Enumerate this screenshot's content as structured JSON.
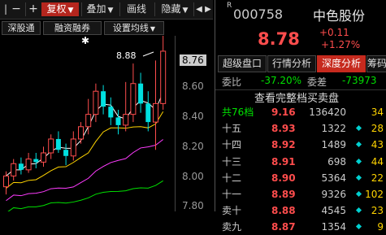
{
  "toolbar": {
    "prev": "|",
    "minus": "−",
    "plus": "+",
    "fuquan": "复权",
    "diejia": "叠加",
    "huaxian": "画线",
    "yincang": "隐藏",
    "arrow_left": "◀",
    "arrow_right": "▶"
  },
  "subbar": {
    "shengutong": "深股通",
    "rongzi": "融资融券",
    "shezhi": "设置均线"
  },
  "chart": {
    "high_marker": "8.88",
    "axis_labels": [
      "8.76",
      "8.60",
      "8.40",
      "8.20",
      "8.00",
      "7.80"
    ]
  },
  "chart_data": {
    "type": "candlestick",
    "ohlc": [
      [
        7.88,
        7.95,
        7.83,
        7.98
      ],
      [
        7.95,
        8.03,
        7.92,
        8.06
      ],
      [
        8.03,
        7.99,
        7.96,
        8.07
      ],
      [
        7.99,
        8.06,
        7.97,
        8.1
      ],
      [
        8.06,
        8.04,
        8.0,
        8.1
      ],
      [
        8.04,
        8.1,
        8.01,
        8.14
      ],
      [
        8.1,
        8.19,
        8.06,
        8.22
      ],
      [
        8.19,
        8.12,
        8.1,
        8.24
      ],
      [
        8.12,
        8.08,
        8.02,
        8.16
      ],
      [
        8.08,
        8.19,
        8.05,
        8.24
      ],
      [
        8.19,
        8.27,
        8.16,
        8.3
      ],
      [
        8.27,
        8.35,
        8.22,
        8.45
      ],
      [
        8.35,
        8.5,
        8.3,
        8.55
      ],
      [
        8.5,
        8.4,
        8.35,
        8.54
      ],
      [
        8.4,
        8.33,
        8.28,
        8.46
      ],
      [
        8.33,
        8.28,
        8.22,
        8.38
      ],
      [
        8.28,
        8.35,
        8.24,
        8.56
      ],
      [
        8.35,
        8.55,
        8.3,
        8.68
      ],
      [
        8.55,
        8.42,
        8.36,
        8.62
      ],
      [
        8.42,
        8.3,
        8.24,
        8.5
      ],
      [
        8.3,
        8.42,
        8.12,
        8.7
      ],
      [
        8.42,
        8.76,
        8.38,
        8.88
      ]
    ],
    "ylim": [
      7.72,
      8.86
    ],
    "ma_colors": [
      "#ffffff",
      "#ffd400",
      "#ff3cff",
      "#00e000"
    ]
  },
  "quote": {
    "code_prefix": "R",
    "code": "000758",
    "name": "中色股份",
    "price": "8.78",
    "change": "+0.11",
    "change_pct": "+1.27%"
  },
  "tabs": [
    "超级盘口",
    "行情分析",
    "深度分析",
    "筹码"
  ],
  "stats": {
    "weibi_label": "委比",
    "weibi_value": "-37.20%",
    "weicha_label": "委差",
    "weicha_value": "-73973"
  },
  "order_book": {
    "title": "查看完整档买卖盘",
    "rows": [
      {
        "label": "共76档",
        "price": "9.16",
        "vol": "136420",
        "count": "34",
        "dot": false
      },
      {
        "label": "十五",
        "price": "8.93",
        "vol": "1322",
        "count": "28",
        "dot": true
      },
      {
        "label": "十四",
        "price": "8.92",
        "vol": "1489",
        "count": "43",
        "dot": true
      },
      {
        "label": "十三",
        "price": "8.91",
        "vol": "698",
        "count": "44",
        "dot": true
      },
      {
        "label": "十二",
        "price": "8.90",
        "vol": "5364",
        "count": "22",
        "dot": true
      },
      {
        "label": "十一",
        "price": "8.89",
        "vol": "9326",
        "count": "102",
        "dot": true
      },
      {
        "label": "卖十",
        "price": "8.88",
        "vol": "4545",
        "count": "23",
        "dot": true
      },
      {
        "label": "卖九",
        "price": "8.87",
        "vol": "1354",
        "count": "9",
        "dot": true
      }
    ]
  },
  "colors": {
    "up": "#ff4d4d",
    "down": "#00e0e0",
    "tab_active": "#c62a1e",
    "accent_yellow": "#ffd400"
  }
}
